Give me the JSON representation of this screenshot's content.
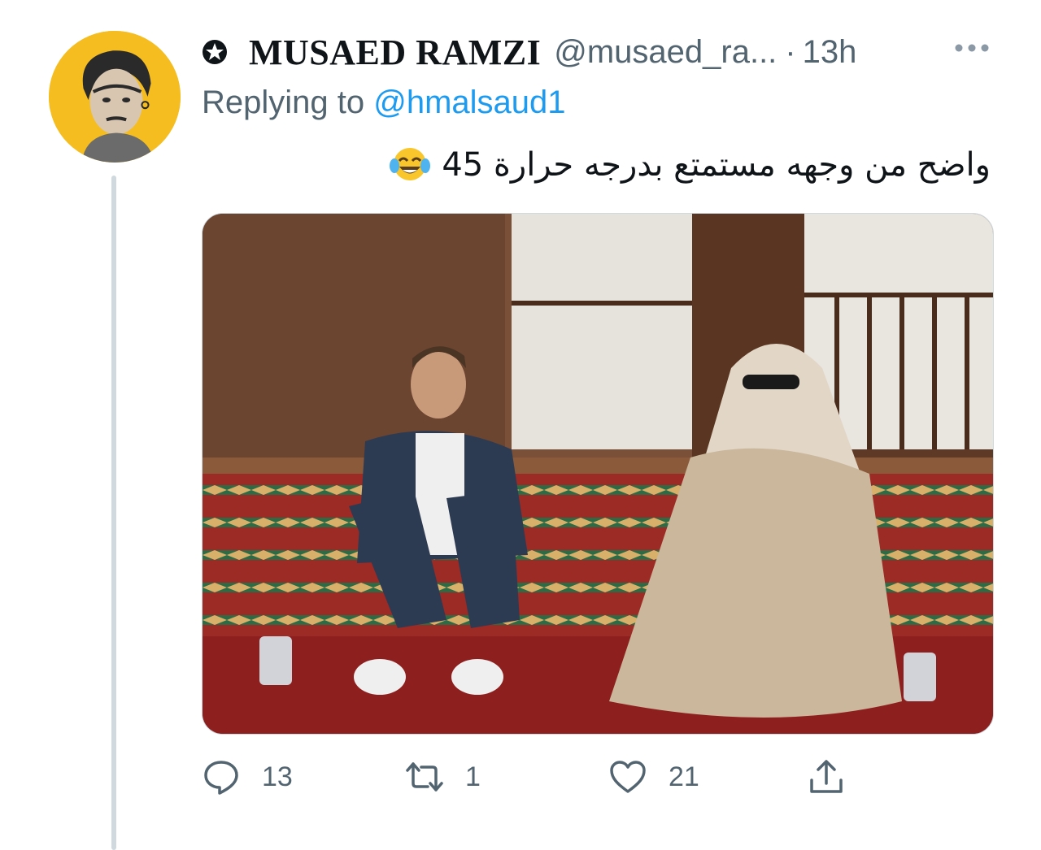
{
  "tweet": {
    "display_name": "MUSAED RAMZI",
    "handle": "@musaed_ra...",
    "separator": "·",
    "time": "13h",
    "replying_prefix": "Replying to",
    "replying_to": "@hmalsaud1",
    "text": "واضح من وجهه مستمتع بدرجه حرارة 45",
    "emoji": "face-with-tears-of-joy-icon",
    "media_description_icon": "photo"
  },
  "actions": {
    "reply_count": "13",
    "retweet_count": "1",
    "like_count": "21"
  },
  "colors": {
    "primary_text": "#0f1419",
    "secondary_text": "#536471",
    "link": "#1d9bf0",
    "thread_line": "#cfd9de",
    "avatar_bg": "#f5bd1f"
  }
}
